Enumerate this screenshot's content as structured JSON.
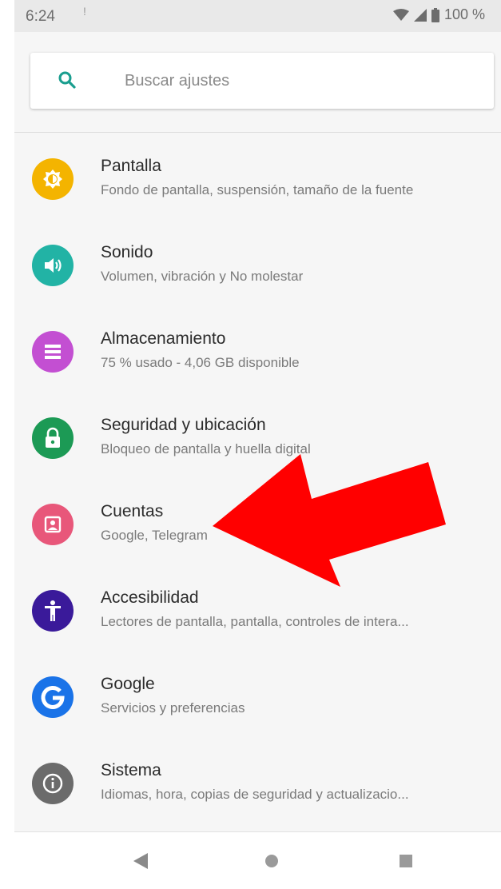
{
  "status_bar": {
    "time": "6:24",
    "notification": "!",
    "battery": "100 %",
    "icons": [
      "wifi-icon",
      "signal-icon",
      "battery-icon"
    ]
  },
  "search": {
    "placeholder": "Buscar ajustes",
    "icon": "search-icon",
    "accent": "#1a9e8f"
  },
  "settings": [
    {
      "title": "Pantalla",
      "subtitle": "Fondo de pantalla, suspensión, tamaño de la fuente",
      "icon": "brightness-icon",
      "color": "#f4b400"
    },
    {
      "title": "Sonido",
      "subtitle": "Volumen, vibración y No molestar",
      "icon": "volume-icon",
      "color": "#22b3a5"
    },
    {
      "title": "Almacenamiento",
      "subtitle": "75 % usado - 4,06 GB disponible",
      "icon": "storage-icon",
      "color": "#c34fd2"
    },
    {
      "title": "Seguridad y ubicación",
      "subtitle": "Bloqueo de pantalla y huella digital",
      "icon": "lock-icon",
      "color": "#1c9a55"
    },
    {
      "title": "Cuentas",
      "subtitle": "Google, Telegram",
      "icon": "account-icon",
      "color": "#e8577a"
    },
    {
      "title": "Accesibilidad",
      "subtitle": "Lectores de pantalla, pantalla, controles de intera...",
      "icon": "accessibility-icon",
      "color": "#3a1a9a"
    },
    {
      "title": "Google",
      "subtitle": "Servicios y preferencias",
      "icon": "google-icon",
      "color": "#1a73e8"
    },
    {
      "title": "Sistema",
      "subtitle": "Idiomas, hora, copias de seguridad y actualizacio...",
      "icon": "info-icon",
      "color": "#6b6b6b"
    }
  ],
  "annotation": {
    "icon": "red-arrow-icon",
    "color": "#ff0000"
  },
  "nav_bar": [
    "back-icon",
    "home-icon",
    "recents-icon"
  ]
}
